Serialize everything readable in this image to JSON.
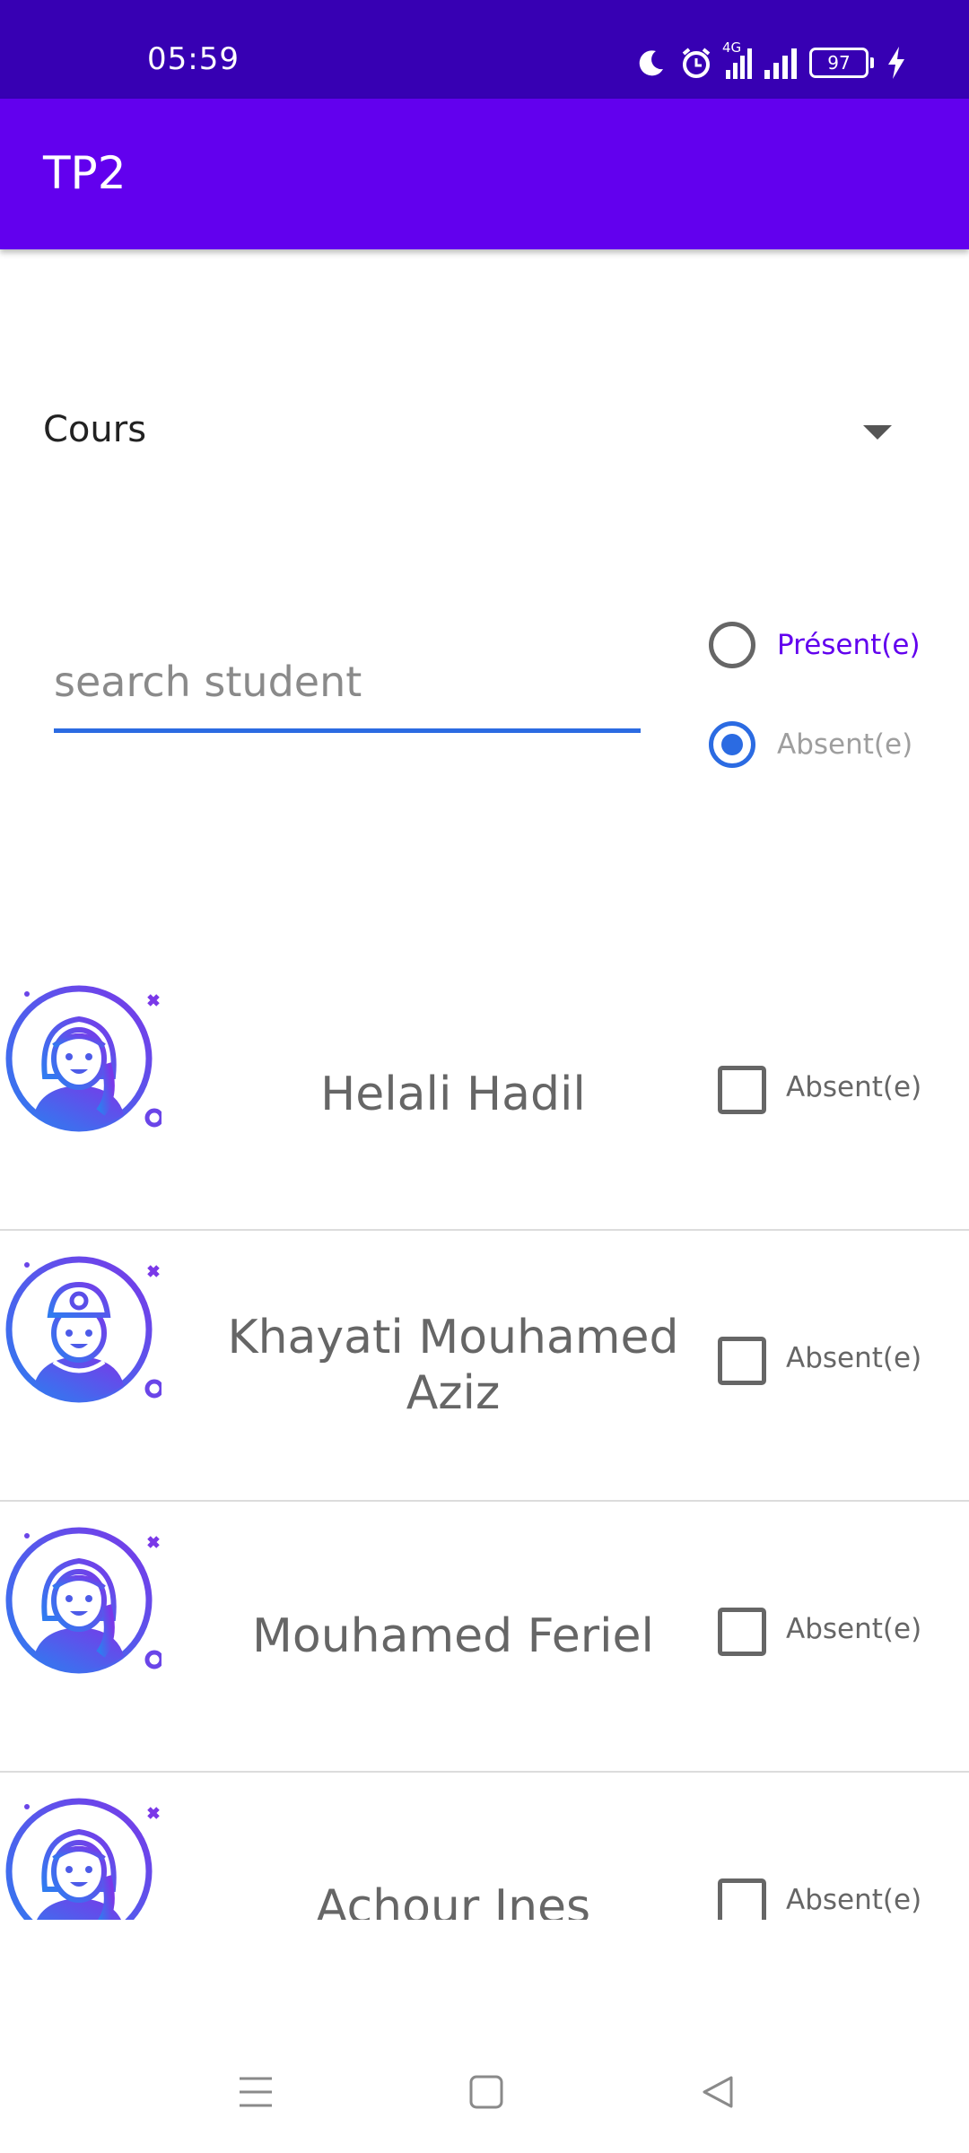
{
  "status_bar": {
    "time": "05:59",
    "network": "4G",
    "battery": "97",
    "icons": [
      "moon-icon",
      "alarm-icon",
      "signal-4g-icon",
      "signal-icon",
      "battery-icon",
      "charging-bolt-icon"
    ]
  },
  "app_bar": {
    "title": "TP2"
  },
  "course_spinner": {
    "selected": "Cours",
    "icon": "dropdown-arrow-icon"
  },
  "search": {
    "placeholder": "search student",
    "value": ""
  },
  "filter": {
    "present_label": "Présent(e)",
    "absent_label": "Absent(e)",
    "selected": "Absent(e)"
  },
  "students": [
    {
      "name": "Helali Hadil",
      "avatar": "girl-avatar-icon",
      "check_label": "Absent(e)",
      "checked": false
    },
    {
      "name": "Khayati Mouhamed Aziz",
      "avatar": "boy-cap-avatar-icon",
      "check_label": "Absent(e)",
      "checked": false
    },
    {
      "name": "Mouhamed Feriel",
      "avatar": "girl-avatar-icon",
      "check_label": "Absent(e)",
      "checked": false
    },
    {
      "name": "Achour Ines",
      "avatar": "girl-avatar-icon",
      "check_label": "Absent(e)",
      "checked": false
    }
  ],
  "nav_bar": {
    "icons": [
      "menu-icon",
      "home-square-icon",
      "back-triangle-icon"
    ]
  },
  "colors": {
    "status_bar": "#3700b3",
    "app_bar": "#6200ee",
    "accent": "#2b6be2",
    "present_label": "#6200ee",
    "absent_label": "#9e9e9e"
  }
}
